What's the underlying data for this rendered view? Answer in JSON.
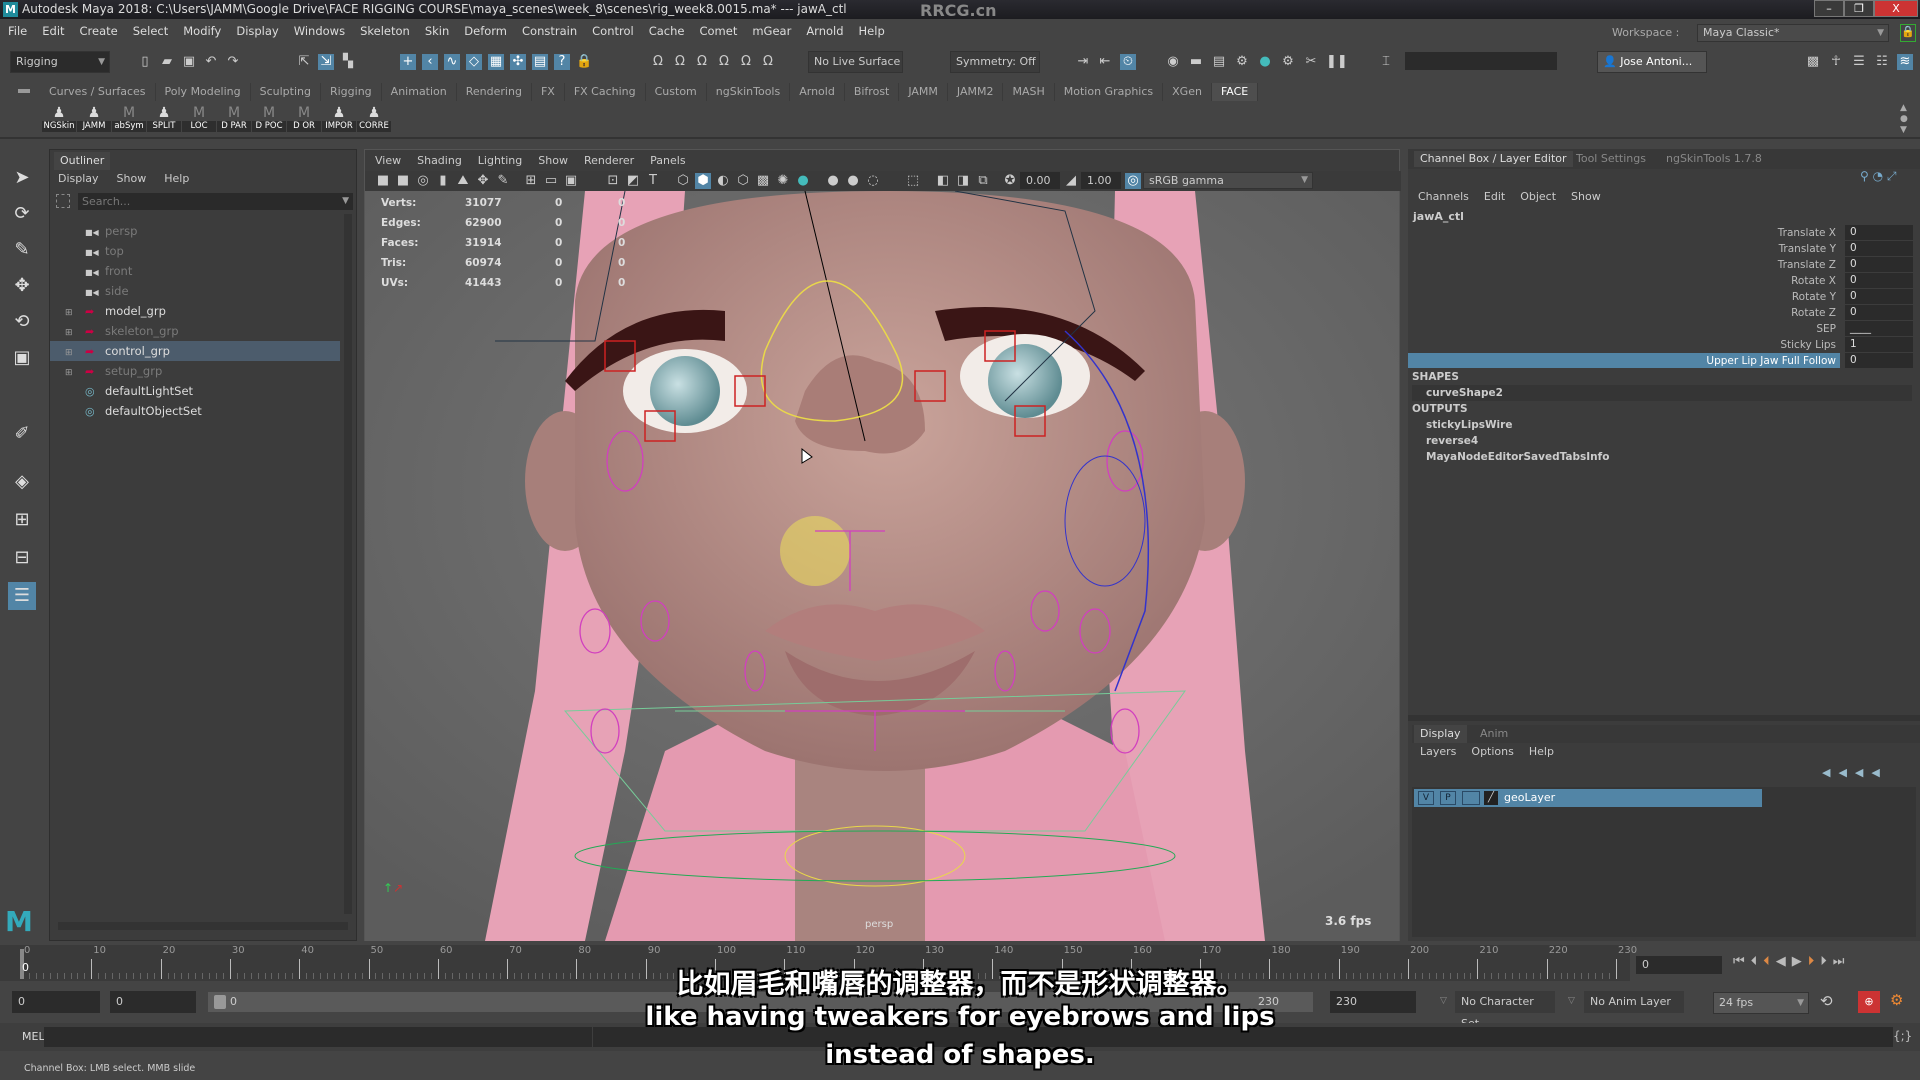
{
  "title_bar": {
    "logo": "M",
    "title": "Autodesk Maya 2018: C:\\Users\\JAMM\\Google Drive\\FACE RIGGING COURSE\\maya_scenes\\week_8\\scenes\\rig_week8.0015.ma*   ---   jawA_ctl",
    "watermark": "RRCG.cn",
    "minimize": "–",
    "maximize": "❐",
    "close": "X"
  },
  "menu": [
    "File",
    "Edit",
    "Create",
    "Select",
    "Modify",
    "Display",
    "Windows",
    "Skeleton",
    "Skin",
    "Deform",
    "Constrain",
    "Control",
    "Cache",
    "Comet",
    "mGear",
    "Arnold",
    "Help"
  ],
  "workspace": {
    "label": "Workspace :",
    "value": "Maya Classic*"
  },
  "toolbar": {
    "menuset": "Rigging",
    "live_surface": "No Live Surface",
    "symmetry": "Symmetry: Off",
    "user": "Jose Antoni..."
  },
  "shelf_tabs": [
    "Curves / Surfaces",
    "Poly Modeling",
    "Sculpting",
    "Rigging",
    "Animation",
    "Rendering",
    "FX",
    "FX Caching",
    "Custom",
    "ngSkinTools",
    "Arnold",
    "Bifrost",
    "JAMM",
    "JAMM2",
    "MASH",
    "Motion Graphics",
    "XGen",
    "FACE"
  ],
  "shelf_active": "FACE",
  "shelf_buttons": [
    {
      "label": "NGSkin",
      "icon": "python-icon"
    },
    {
      "label": "JAMM",
      "icon": "python-icon"
    },
    {
      "label": "abSym",
      "icon": "mel-icon"
    },
    {
      "label": "SPLIT",
      "icon": "python-icon"
    },
    {
      "label": "LOC",
      "icon": "mel-icon"
    },
    {
      "label": "D PAR",
      "icon": "mel-icon"
    },
    {
      "label": "D POC",
      "icon": "mel-icon"
    },
    {
      "label": "D OR",
      "icon": "mel-icon"
    },
    {
      "label": "IMPOR",
      "icon": "python-icon"
    },
    {
      "label": "CORRE",
      "icon": "python-icon"
    }
  ],
  "outliner": {
    "tab": "Outliner",
    "menu": [
      "Display",
      "Show",
      "Help"
    ],
    "search_placeholder": "Search...",
    "items": [
      {
        "label": "persp",
        "type": "camera",
        "dim": true
      },
      {
        "label": "top",
        "type": "camera",
        "dim": true
      },
      {
        "label": "front",
        "type": "camera",
        "dim": true
      },
      {
        "label": "side",
        "type": "camera",
        "dim": true
      },
      {
        "label": "model_grp",
        "type": "group",
        "dim": false
      },
      {
        "label": "skeleton_grp",
        "type": "group",
        "dim": true
      },
      {
        "label": "control_grp",
        "type": "group",
        "dim": false,
        "selected": true
      },
      {
        "label": "setup_grp",
        "type": "group",
        "dim": true
      },
      {
        "label": "defaultLightSet",
        "type": "set",
        "dim": false
      },
      {
        "label": "defaultObjectSet",
        "type": "set",
        "dim": false
      }
    ]
  },
  "viewport": {
    "menu": [
      "View",
      "Shading",
      "Lighting",
      "Show",
      "Renderer",
      "Panels"
    ],
    "exposure": "0.00",
    "gamma": "1.00",
    "color_space": "sRGB gamma",
    "stats": [
      {
        "label": "Verts:",
        "value": "31077",
        "a": "0",
        "b": "0"
      },
      {
        "label": "Edges:",
        "value": "62900",
        "a": "0",
        "b": "0"
      },
      {
        "label": "Faces:",
        "value": "31914",
        "a": "0",
        "b": "0"
      },
      {
        "label": "Tris:",
        "value": "60974",
        "a": "0",
        "b": "0"
      },
      {
        "label": "UVs:",
        "value": "41443",
        "a": "0",
        "b": "0"
      }
    ],
    "camera": "persp",
    "fps": "3.6 fps"
  },
  "channel_box": {
    "tabs": [
      "Channel Box / Layer Editor",
      "Tool Settings",
      "ngSkinTools 1.7.8"
    ],
    "menu": [
      "Channels",
      "Edit",
      "Object",
      "Show"
    ],
    "object": "jawA_ctl",
    "attrs": [
      {
        "name": "Translate X",
        "value": "0"
      },
      {
        "name": "Translate Y",
        "value": "0"
      },
      {
        "name": "Translate Z",
        "value": "0"
      },
      {
        "name": "Rotate X",
        "value": "0"
      },
      {
        "name": "Rotate Y",
        "value": "0"
      },
      {
        "name": "Rotate Z",
        "value": "0"
      },
      {
        "name": "SEP",
        "value": "____"
      },
      {
        "name": "Sticky Lips",
        "value": "1"
      },
      {
        "name": "Upper Lip Jaw Full Follow",
        "value": "0",
        "selected": true
      }
    ],
    "shapes_header": "SHAPES",
    "shapes": [
      "curveShape2"
    ],
    "outputs_header": "OUTPUTS",
    "outputs": [
      "stickyLipsWire",
      "reverse4",
      "MayaNodeEditorSavedTabsInfo"
    ]
  },
  "layer_editor": {
    "tabs": [
      "Display",
      "Anim"
    ],
    "menu": [
      "Layers",
      "Options",
      "Help"
    ],
    "layer": {
      "v": "V",
      "p": "P",
      "name": "geoLayer"
    }
  },
  "timeline": {
    "ticks": [
      "0",
      "10",
      "20",
      "30",
      "40",
      "50",
      "60",
      "70",
      "80",
      "90",
      "100",
      "110",
      "120",
      "130",
      "140",
      "150",
      "160",
      "170",
      "180",
      "190",
      "200",
      "210",
      "220",
      "230"
    ],
    "current_frame": "0",
    "frame_field": "0"
  },
  "range": {
    "start": "0",
    "inner_start": "0",
    "slider_start": "0",
    "end_left": "230",
    "end": "230",
    "character_set": "No Character Set",
    "anim_layer": "No Anim Layer",
    "fps": "24 fps"
  },
  "command": {
    "lang": "MEL",
    "help": "Channel Box: LMB select. MMB slide"
  },
  "subtitles": {
    "zh": "比如眉毛和嘴唇的调整器，而不是形状调整器。",
    "en1": "like having tweakers for eyebrows and lips",
    "en2": "instead of shapes."
  },
  "colors": {
    "accent": "#5285a6",
    "selection": "#4c5c6c",
    "hair": "#e7a2b6",
    "skin": "#c49a92",
    "control_magenta": "#d13fbf",
    "control_yellow": "#e9d84a"
  }
}
